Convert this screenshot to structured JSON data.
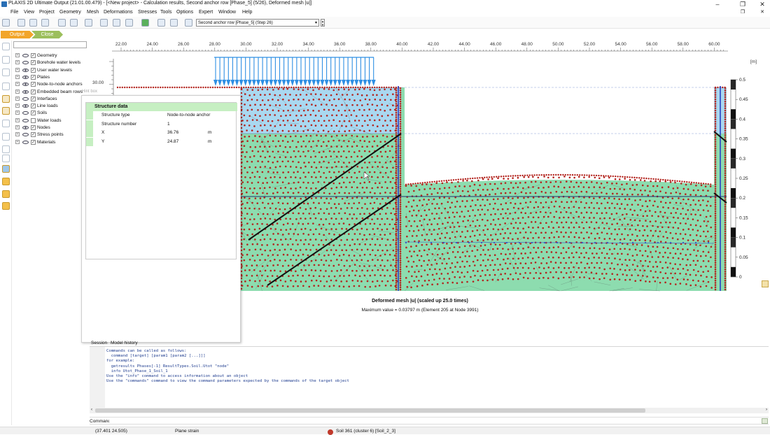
{
  "window": {
    "title": "PLAXIS 2D Ultimate Output (21.01.00.479) - [<New project> - Calculation results, Second anchor row [Phase_5] (5/26), Deformed mesh |u|]",
    "app_icon": "plaxis-icon"
  },
  "menu": [
    "File",
    "View",
    "Project",
    "Geometry",
    "Mesh",
    "Deformations",
    "Stresses",
    "Tools",
    "Options",
    "Expert",
    "Window",
    "Help"
  ],
  "toolbar": {
    "phase_select": "Second anchor row [Phase_5] (Step 26)"
  },
  "tabs": {
    "output": "Output",
    "close": "Close"
  },
  "tree": [
    {
      "label": "Geometry",
      "checked": true,
      "visible": false
    },
    {
      "label": "Borehole water levels",
      "checked": true,
      "visible": false
    },
    {
      "label": "User water levels",
      "checked": true,
      "visible": true
    },
    {
      "label": "Plates",
      "checked": true,
      "visible": true
    },
    {
      "label": "Node-to-node anchors",
      "checked": true,
      "visible": true
    },
    {
      "label": "Embedded beam rows",
      "checked": true,
      "visible": true
    },
    {
      "label": "Interfaces",
      "checked": true,
      "visible": false
    },
    {
      "label": "Line loads",
      "checked": true,
      "visible": true
    },
    {
      "label": "Soils",
      "checked": true,
      "visible": false
    },
    {
      "label": "Water loads",
      "checked": false,
      "visible": false
    },
    {
      "label": "Nodes",
      "checked": true,
      "visible": true
    },
    {
      "label": "Stress points",
      "checked": true,
      "visible": false
    },
    {
      "label": "Materials",
      "checked": true,
      "visible": false
    }
  ],
  "hintbox": {
    "header": "Hint box",
    "title": "Structure data",
    "rows": [
      {
        "key": "Structure type",
        "value": "Node-to-node anchor",
        "unit": ""
      },
      {
        "key": "Structure number",
        "value": "1",
        "unit": ""
      },
      {
        "key": "X",
        "value": "36.76",
        "unit": "m"
      },
      {
        "key": "Y",
        "value": "24.87",
        "unit": "m"
      }
    ]
  },
  "plot": {
    "x_ticks": [
      "22.00",
      "24.00",
      "26.00",
      "28.00",
      "30.00",
      "32.00",
      "34.00",
      "36.00",
      "38.00",
      "40.00",
      "42.00",
      "44.00",
      "46.00",
      "48.00",
      "50.00",
      "52.00",
      "54.00",
      "56.00",
      "58.00",
      "60.00"
    ],
    "y_tick": "30.00",
    "unit": "[m]",
    "legend_ticks": [
      "0.5",
      "0.45",
      "0.4",
      "0.35",
      "0.3",
      "0.25",
      "0.2",
      "0.15",
      "0.1",
      "0.05",
      "0"
    ],
    "caption_title": "Deformed mesh |u| (scaled up 25.0 times)",
    "caption_max": "Maximum value = 0.03797 m (Element 205 at Node 3991)",
    "colors": {
      "soil": "#8ddcaf",
      "water": "#a9d8f0",
      "node": "#b3241e",
      "load": "#2f8fe3",
      "anchor": "#111111",
      "plate": "#2b3fc4"
    }
  },
  "session": {
    "tabs": [
      "Session",
      "Model history"
    ],
    "lines": [
      "Commands can be called as follows:",
      "  command [target] [param1 [param2 [...]]]",
      "for example:",
      "  getresults Phases[-1] ResultTypes.Soil.Utot \"node\"",
      "  info Utot_Phase_1_Soil_1",
      "Use the \"info\" command to access information about an object",
      "Use the \"commands\" command to view the command parameters expected by the commands of the target object"
    ],
    "command_label": "Command"
  },
  "status": {
    "coords": "(37.401 24.505)",
    "mode": "Plane strain",
    "soil": "Soil 361 (cluster 6) [Soil_2_3]"
  }
}
